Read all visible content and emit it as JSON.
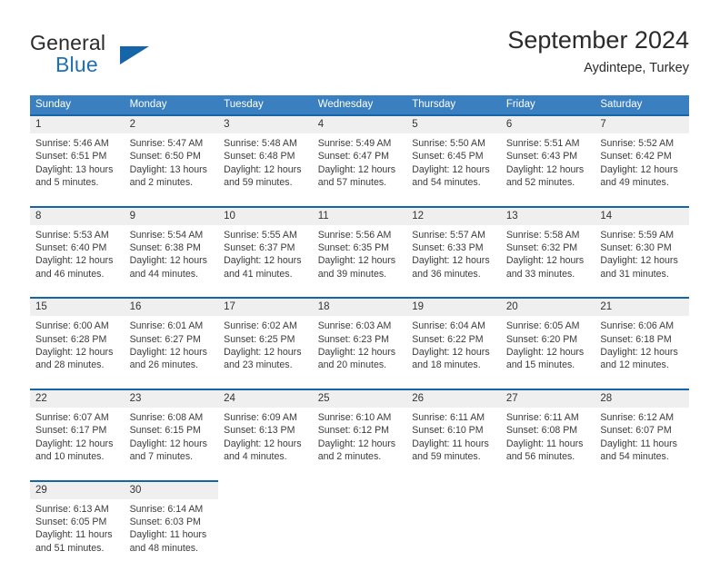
{
  "brand": {
    "name_top": "General",
    "name_bottom": "Blue",
    "flag_icon": "triangle-flag-icon",
    "accent_color": "#1f6fb5"
  },
  "header": {
    "title": "September 2024",
    "subtitle": "Aydintepe, Turkey"
  },
  "colors": {
    "header_row": "#3a7fbf",
    "week_separator": "#1565a8",
    "daynum_strip": "#efefef",
    "brand_dark": "#2b2b2b"
  },
  "weekday_headers": [
    "Sunday",
    "Monday",
    "Tuesday",
    "Wednesday",
    "Thursday",
    "Friday",
    "Saturday"
  ],
  "labels": {
    "sunrise_prefix": "Sunrise:",
    "sunset_prefix": "Sunset:",
    "daylight_prefix": "Daylight:"
  },
  "weeks": [
    [
      {
        "day": "1",
        "sunrise": "Sunrise: 5:46 AM",
        "sunset": "Sunset: 6:51 PM",
        "daylight_line1": "Daylight: 13 hours",
        "daylight_line2": "and 5 minutes."
      },
      {
        "day": "2",
        "sunrise": "Sunrise: 5:47 AM",
        "sunset": "Sunset: 6:50 PM",
        "daylight_line1": "Daylight: 13 hours",
        "daylight_line2": "and 2 minutes."
      },
      {
        "day": "3",
        "sunrise": "Sunrise: 5:48 AM",
        "sunset": "Sunset: 6:48 PM",
        "daylight_line1": "Daylight: 12 hours",
        "daylight_line2": "and 59 minutes."
      },
      {
        "day": "4",
        "sunrise": "Sunrise: 5:49 AM",
        "sunset": "Sunset: 6:47 PM",
        "daylight_line1": "Daylight: 12 hours",
        "daylight_line2": "and 57 minutes."
      },
      {
        "day": "5",
        "sunrise": "Sunrise: 5:50 AM",
        "sunset": "Sunset: 6:45 PM",
        "daylight_line1": "Daylight: 12 hours",
        "daylight_line2": "and 54 minutes."
      },
      {
        "day": "6",
        "sunrise": "Sunrise: 5:51 AM",
        "sunset": "Sunset: 6:43 PM",
        "daylight_line1": "Daylight: 12 hours",
        "daylight_line2": "and 52 minutes."
      },
      {
        "day": "7",
        "sunrise": "Sunrise: 5:52 AM",
        "sunset": "Sunset: 6:42 PM",
        "daylight_line1": "Daylight: 12 hours",
        "daylight_line2": "and 49 minutes."
      }
    ],
    [
      {
        "day": "8",
        "sunrise": "Sunrise: 5:53 AM",
        "sunset": "Sunset: 6:40 PM",
        "daylight_line1": "Daylight: 12 hours",
        "daylight_line2": "and 46 minutes."
      },
      {
        "day": "9",
        "sunrise": "Sunrise: 5:54 AM",
        "sunset": "Sunset: 6:38 PM",
        "daylight_line1": "Daylight: 12 hours",
        "daylight_line2": "and 44 minutes."
      },
      {
        "day": "10",
        "sunrise": "Sunrise: 5:55 AM",
        "sunset": "Sunset: 6:37 PM",
        "daylight_line1": "Daylight: 12 hours",
        "daylight_line2": "and 41 minutes."
      },
      {
        "day": "11",
        "sunrise": "Sunrise: 5:56 AM",
        "sunset": "Sunset: 6:35 PM",
        "daylight_line1": "Daylight: 12 hours",
        "daylight_line2": "and 39 minutes."
      },
      {
        "day": "12",
        "sunrise": "Sunrise: 5:57 AM",
        "sunset": "Sunset: 6:33 PM",
        "daylight_line1": "Daylight: 12 hours",
        "daylight_line2": "and 36 minutes."
      },
      {
        "day": "13",
        "sunrise": "Sunrise: 5:58 AM",
        "sunset": "Sunset: 6:32 PM",
        "daylight_line1": "Daylight: 12 hours",
        "daylight_line2": "and 33 minutes."
      },
      {
        "day": "14",
        "sunrise": "Sunrise: 5:59 AM",
        "sunset": "Sunset: 6:30 PM",
        "daylight_line1": "Daylight: 12 hours",
        "daylight_line2": "and 31 minutes."
      }
    ],
    [
      {
        "day": "15",
        "sunrise": "Sunrise: 6:00 AM",
        "sunset": "Sunset: 6:28 PM",
        "daylight_line1": "Daylight: 12 hours",
        "daylight_line2": "and 28 minutes."
      },
      {
        "day": "16",
        "sunrise": "Sunrise: 6:01 AM",
        "sunset": "Sunset: 6:27 PM",
        "daylight_line1": "Daylight: 12 hours",
        "daylight_line2": "and 26 minutes."
      },
      {
        "day": "17",
        "sunrise": "Sunrise: 6:02 AM",
        "sunset": "Sunset: 6:25 PM",
        "daylight_line1": "Daylight: 12 hours",
        "daylight_line2": "and 23 minutes."
      },
      {
        "day": "18",
        "sunrise": "Sunrise: 6:03 AM",
        "sunset": "Sunset: 6:23 PM",
        "daylight_line1": "Daylight: 12 hours",
        "daylight_line2": "and 20 minutes."
      },
      {
        "day": "19",
        "sunrise": "Sunrise: 6:04 AM",
        "sunset": "Sunset: 6:22 PM",
        "daylight_line1": "Daylight: 12 hours",
        "daylight_line2": "and 18 minutes."
      },
      {
        "day": "20",
        "sunrise": "Sunrise: 6:05 AM",
        "sunset": "Sunset: 6:20 PM",
        "daylight_line1": "Daylight: 12 hours",
        "daylight_line2": "and 15 minutes."
      },
      {
        "day": "21",
        "sunrise": "Sunrise: 6:06 AM",
        "sunset": "Sunset: 6:18 PM",
        "daylight_line1": "Daylight: 12 hours",
        "daylight_line2": "and 12 minutes."
      }
    ],
    [
      {
        "day": "22",
        "sunrise": "Sunrise: 6:07 AM",
        "sunset": "Sunset: 6:17 PM",
        "daylight_line1": "Daylight: 12 hours",
        "daylight_line2": "and 10 minutes."
      },
      {
        "day": "23",
        "sunrise": "Sunrise: 6:08 AM",
        "sunset": "Sunset: 6:15 PM",
        "daylight_line1": "Daylight: 12 hours",
        "daylight_line2": "and 7 minutes."
      },
      {
        "day": "24",
        "sunrise": "Sunrise: 6:09 AM",
        "sunset": "Sunset: 6:13 PM",
        "daylight_line1": "Daylight: 12 hours",
        "daylight_line2": "and 4 minutes."
      },
      {
        "day": "25",
        "sunrise": "Sunrise: 6:10 AM",
        "sunset": "Sunset: 6:12 PM",
        "daylight_line1": "Daylight: 12 hours",
        "daylight_line2": "and 2 minutes."
      },
      {
        "day": "26",
        "sunrise": "Sunrise: 6:11 AM",
        "sunset": "Sunset: 6:10 PM",
        "daylight_line1": "Daylight: 11 hours",
        "daylight_line2": "and 59 minutes."
      },
      {
        "day": "27",
        "sunrise": "Sunrise: 6:11 AM",
        "sunset": "Sunset: 6:08 PM",
        "daylight_line1": "Daylight: 11 hours",
        "daylight_line2": "and 56 minutes."
      },
      {
        "day": "28",
        "sunrise": "Sunrise: 6:12 AM",
        "sunset": "Sunset: 6:07 PM",
        "daylight_line1": "Daylight: 11 hours",
        "daylight_line2": "and 54 minutes."
      }
    ],
    [
      {
        "day": "29",
        "sunrise": "Sunrise: 6:13 AM",
        "sunset": "Sunset: 6:05 PM",
        "daylight_line1": "Daylight: 11 hours",
        "daylight_line2": "and 51 minutes."
      },
      {
        "day": "30",
        "sunrise": "Sunrise: 6:14 AM",
        "sunset": "Sunset: 6:03 PM",
        "daylight_line1": "Daylight: 11 hours",
        "daylight_line2": "and 48 minutes."
      },
      {
        "day": "",
        "sunrise": "",
        "sunset": "",
        "daylight_line1": "",
        "daylight_line2": ""
      },
      {
        "day": "",
        "sunrise": "",
        "sunset": "",
        "daylight_line1": "",
        "daylight_line2": ""
      },
      {
        "day": "",
        "sunrise": "",
        "sunset": "",
        "daylight_line1": "",
        "daylight_line2": ""
      },
      {
        "day": "",
        "sunrise": "",
        "sunset": "",
        "daylight_line1": "",
        "daylight_line2": ""
      },
      {
        "day": "",
        "sunrise": "",
        "sunset": "",
        "daylight_line1": "",
        "daylight_line2": ""
      }
    ]
  ]
}
